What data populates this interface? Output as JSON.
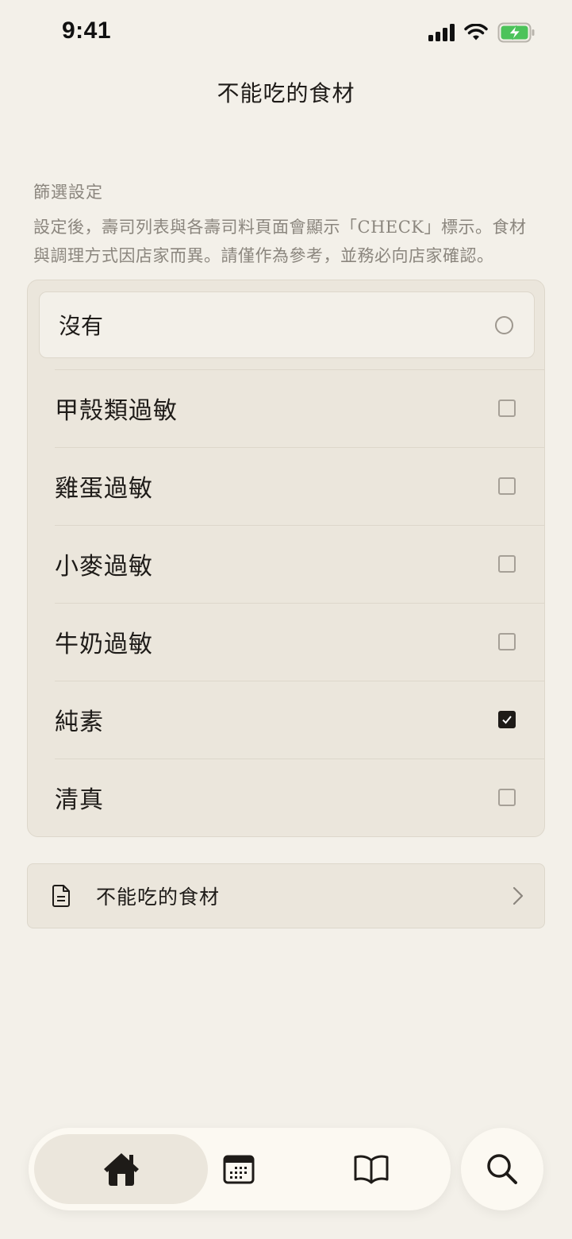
{
  "status_bar": {
    "time": "9:41"
  },
  "header": {
    "title": "不能吃的食材"
  },
  "filter": {
    "section_label": "篩選設定",
    "description": "設定後，壽司列表與各壽司料頁面會顯示「CHECK」標示。食材與調理方式因店家而異。請僅作為參考，並務必向店家確認。",
    "none_option": {
      "label": "沒有",
      "selected": false
    },
    "options": [
      {
        "label": "甲殼類過敏",
        "checked": false
      },
      {
        "label": "雞蛋過敏",
        "checked": false
      },
      {
        "label": "小麥過敏",
        "checked": false
      },
      {
        "label": "牛奶過敏",
        "checked": false
      },
      {
        "label": "純素",
        "checked": true
      },
      {
        "label": "清真",
        "checked": false
      }
    ]
  },
  "link": {
    "label": "不能吃的食材",
    "icon": "document-icon"
  },
  "tab_bar": {
    "tabs": [
      {
        "icon": "home-icon",
        "active": true
      },
      {
        "icon": "calendar-icon",
        "active": false
      },
      {
        "icon": "book-icon",
        "active": false
      }
    ],
    "search_icon": "search-icon"
  },
  "colors": {
    "background": "#f3f0e9",
    "card": "#ebe6dc",
    "text": "#1e1b18",
    "muted_text": "#8b867e",
    "battery_green": "#4cc35a"
  }
}
